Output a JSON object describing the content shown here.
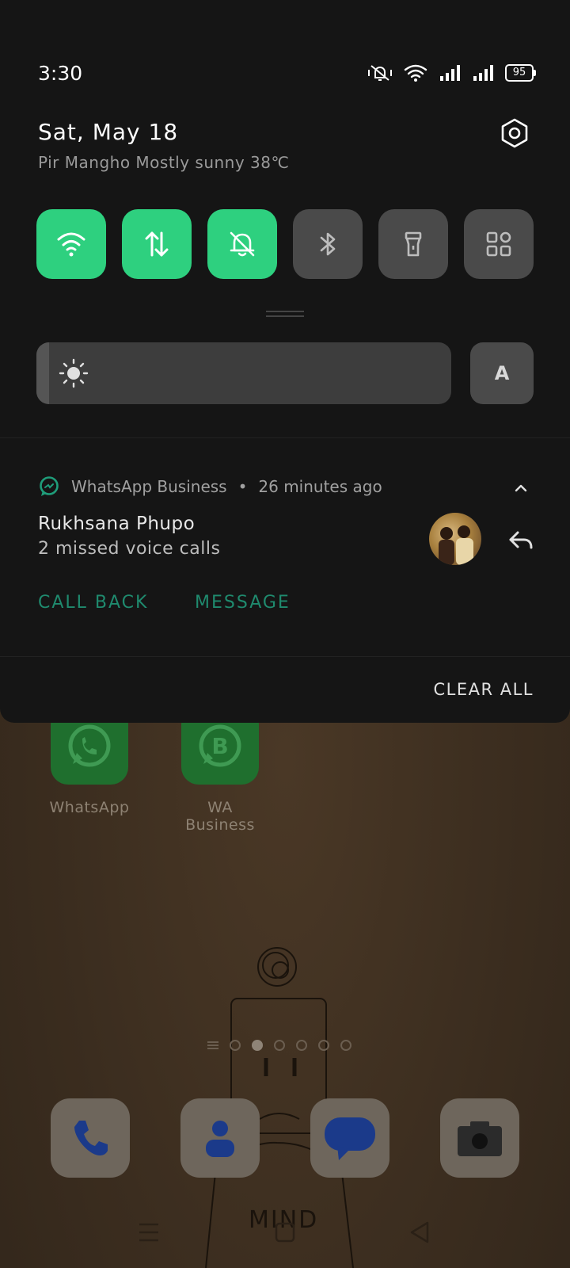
{
  "status_bar": {
    "time": "3:30",
    "battery": "95",
    "icons": [
      "vibrate-silent-icon",
      "wifi-icon",
      "signal-icon",
      "signal-icon"
    ]
  },
  "header": {
    "date": "Sat, May 18",
    "weather": "Pir Mangho Mostly sunny 38℃",
    "settings_icon": "settings-icon"
  },
  "quick_tiles": [
    {
      "icon": "wifi-icon",
      "state": "on"
    },
    {
      "icon": "mobile-data-icon",
      "state": "on"
    },
    {
      "icon": "silent-mode-icon",
      "state": "on"
    },
    {
      "icon": "bluetooth-icon",
      "state": "off"
    },
    {
      "icon": "flashlight-icon",
      "state": "off"
    },
    {
      "icon": "more-tiles-icon",
      "state": "off"
    }
  ],
  "brightness": {
    "level": 0.03,
    "auto_label": "A"
  },
  "notification": {
    "app_name": "WhatsApp Business",
    "separator": "•",
    "time_ago": "26 minutes ago",
    "title": "Rukhsana Phupo",
    "body": "2 missed voice calls",
    "actions": [
      "CALL BACK",
      "MESSAGE"
    ]
  },
  "clear_all": "CLEAR ALL",
  "home": {
    "apps": [
      {
        "label": "WhatsApp"
      },
      {
        "label": "WA Business"
      }
    ],
    "dock": [
      "phone-icon",
      "contacts-icon",
      "messages-icon",
      "camera-icon"
    ],
    "wallpaper_text": "MIND"
  },
  "colors": {
    "tile_on": "#2ed07f",
    "tile_off": "#4a4a4a",
    "action_green": "#1f8a6e",
    "shade_bg": "#151515"
  }
}
